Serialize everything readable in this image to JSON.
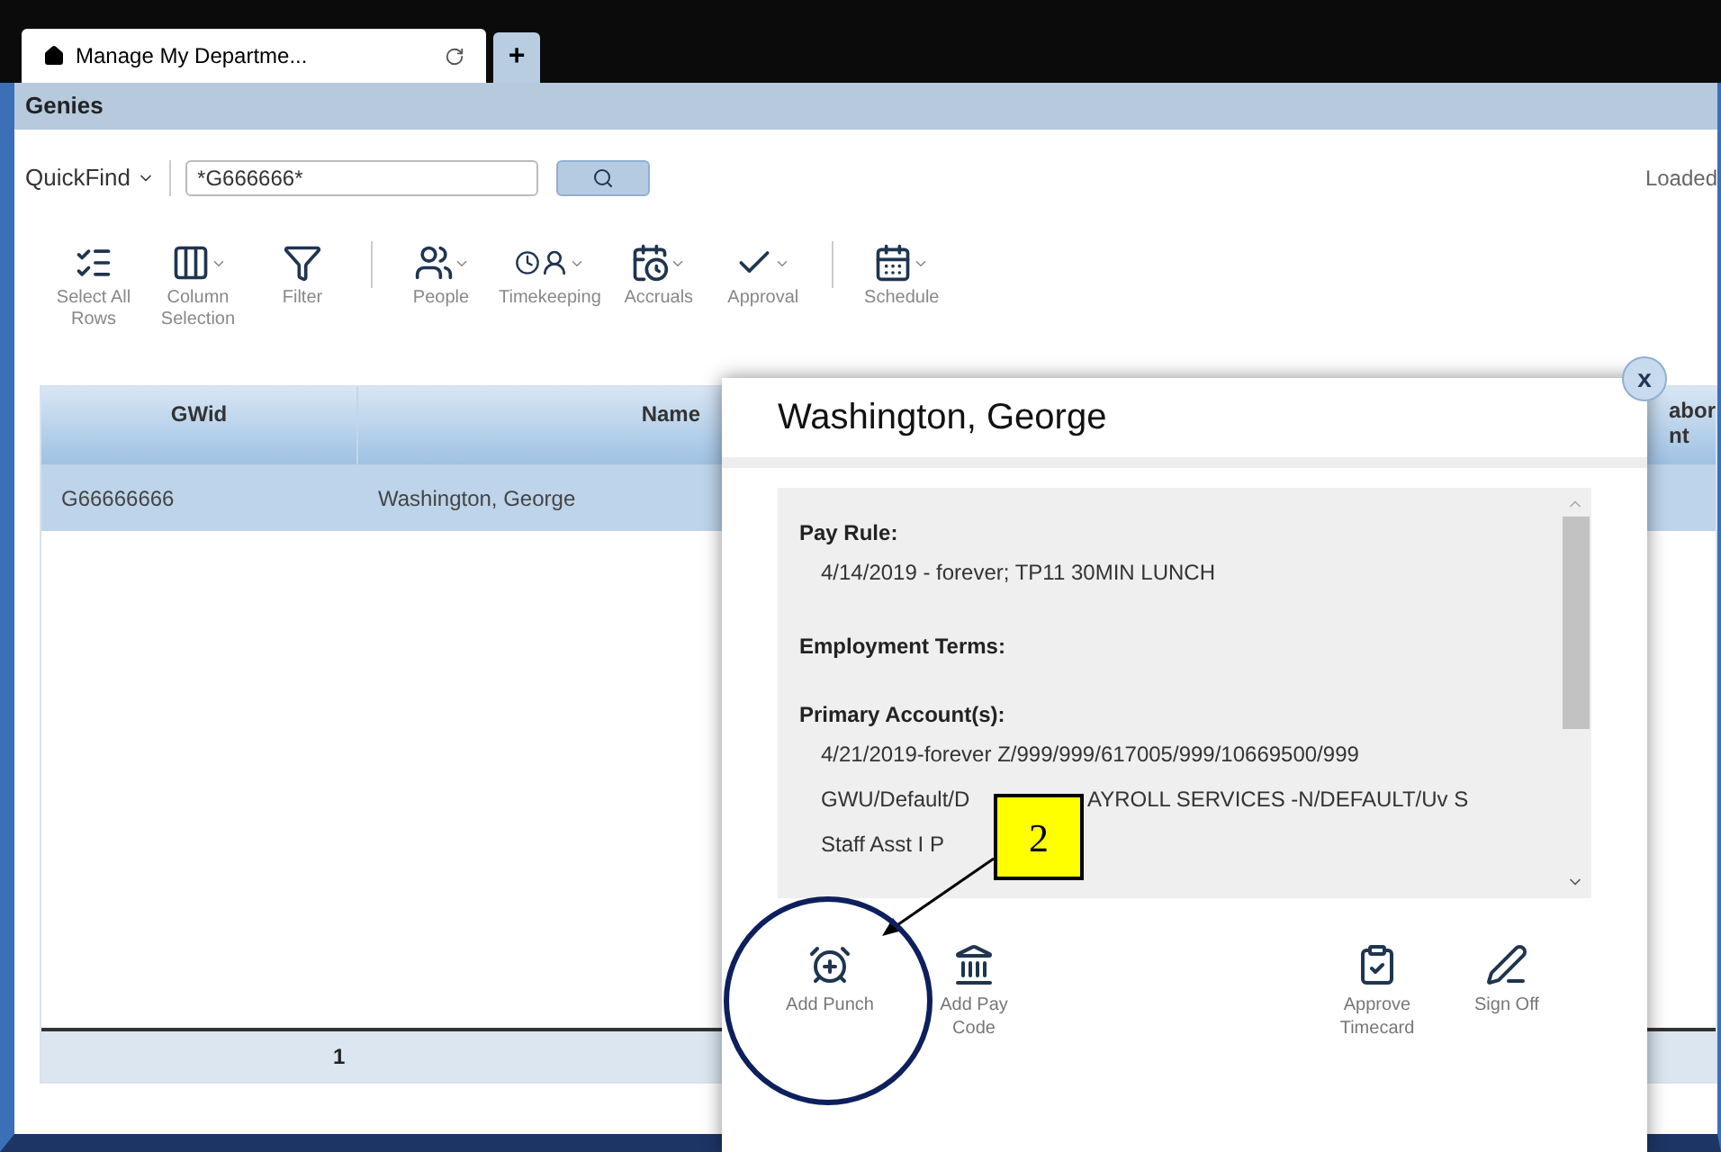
{
  "tabs": [
    {
      "label": "Manage My Departme...",
      "selected": true
    }
  ],
  "new_tab": "+",
  "panel_title": "Genies",
  "quickfind": {
    "label": "QuickFind",
    "value": "*G666666*"
  },
  "status": "Loaded",
  "toolbar": [
    {
      "label": "Select All\nRows",
      "kind": "select",
      "dropdown": false
    },
    {
      "label": "Column\nSelection",
      "kind": "columns",
      "dropdown": true
    },
    {
      "label": "Filter",
      "kind": "filter",
      "dropdown": false
    },
    {
      "kind": "separator"
    },
    {
      "label": "People",
      "kind": "people",
      "dropdown": true
    },
    {
      "label": "Timekeeping",
      "kind": "timekeeping",
      "dropdown": true
    },
    {
      "label": "Accruals",
      "kind": "accruals",
      "dropdown": true
    },
    {
      "label": "Approval",
      "kind": "approval",
      "dropdown": true
    },
    {
      "kind": "separator"
    },
    {
      "label": "Schedule",
      "kind": "schedule",
      "dropdown": true
    }
  ],
  "table": {
    "columns": [
      "GWid",
      "Name",
      "abor\nnt"
    ],
    "rows": [
      {
        "cells": [
          "G66666666",
          "Washington, George"
        ],
        "selected": true
      }
    ],
    "footer": "1"
  },
  "popup": {
    "title": "Washington, George",
    "close": "x",
    "sections": [
      {
        "heading": "Pay Rule:",
        "lines": [
          {
            "parts": [
              "4/14/2019 - forever; TP11 30MIN LUNCH"
            ]
          }
        ]
      },
      {
        "heading": "Employment Terms:"
      },
      {
        "heading": "Primary Account(s):",
        "lines": [
          {
            "parts": [
              "4/21/2019-forever Z/999/999/617005/999/10669500/999"
            ]
          },
          {
            "parts": [
              "GWU/Default/D",
              "AYROLL SERVICES -N/DEFAULT/Uv S"
            ]
          },
          {
            "parts": [
              "Staff Asst I P"
            ]
          }
        ]
      }
    ],
    "actions_left": [
      {
        "label": "Add Punch",
        "kind": "punch"
      },
      {
        "label": "Add Pay\nCode",
        "kind": "paycode"
      }
    ],
    "actions_right": [
      {
        "label": "Approve\nTimecard",
        "kind": "approve"
      },
      {
        "label": "Sign Off",
        "kind": "signoff"
      }
    ]
  },
  "annotation": {
    "callout": "2"
  }
}
